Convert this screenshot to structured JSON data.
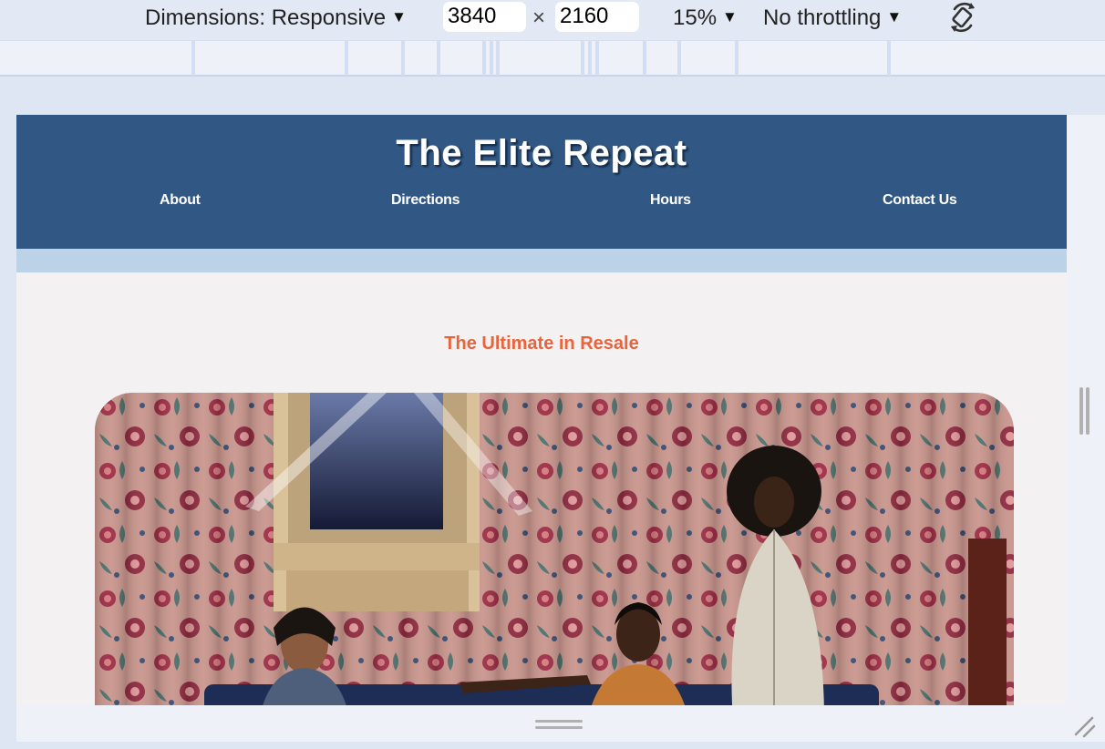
{
  "devtools": {
    "dimensions_label": "Dimensions: Responsive",
    "width_value": "3840",
    "height_value": "2160",
    "times_symbol": "×",
    "zoom_label": "15%",
    "throttling_label": "No throttling",
    "dropdown_arrow": "▼",
    "rotate_icon": "rotate-device-icon"
  },
  "site": {
    "title": "The Elite Repeat",
    "nav": [
      {
        "label": "About"
      },
      {
        "label": "Directions"
      },
      {
        "label": "Hours"
      },
      {
        "label": "Contact Us"
      }
    ],
    "tagline": "The Ultimate in Resale",
    "hero_image": "hero-photo-three-women-floral-curtains"
  },
  "colors": {
    "header_bg": "#315885",
    "sub_band": "#bcd3e7",
    "tagline": "#e9633b",
    "page_bg": "#f4f1f3"
  }
}
